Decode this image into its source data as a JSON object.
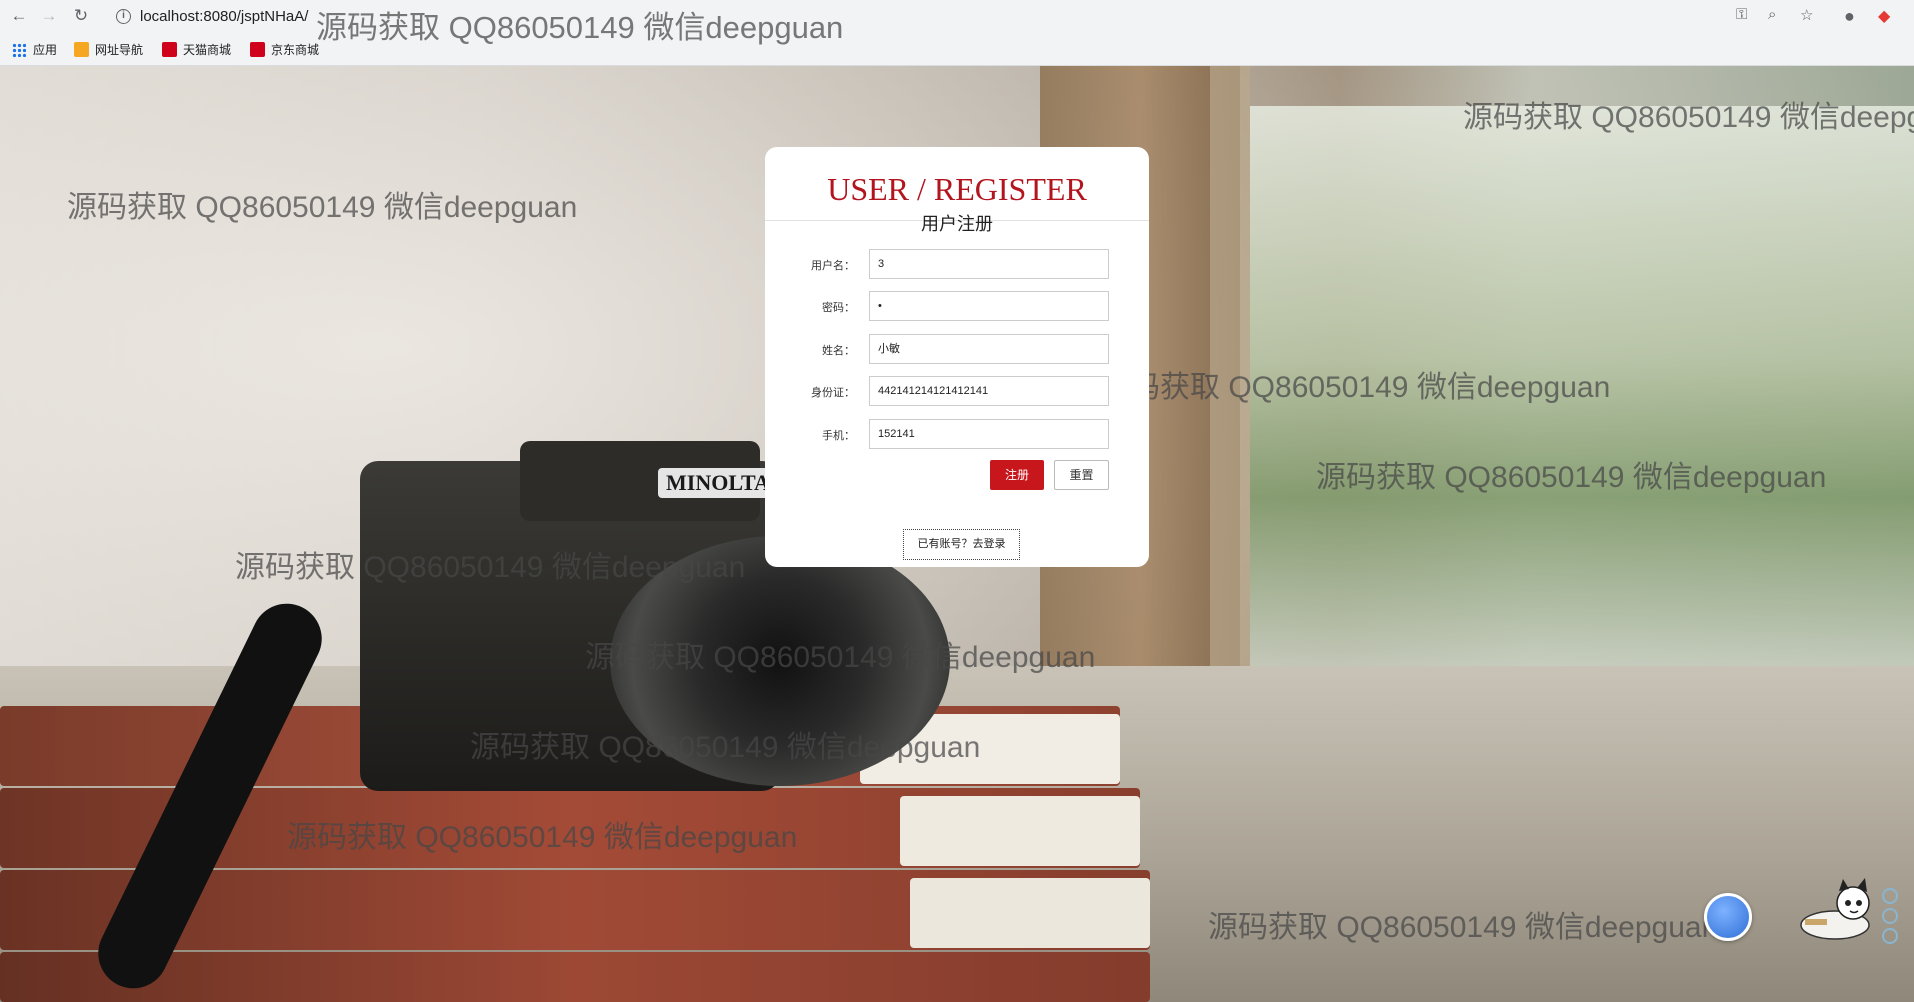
{
  "browser": {
    "url": "localhost:8080/jsptNHaA/",
    "url_text": "localhost:8080/jsptNHaA/",
    "bookmarks": [
      {
        "label": "应用",
        "icon": "apps-grid-icon"
      },
      {
        "label": "网址导航",
        "icon": "star-folder-icon",
        "color": "#f5a623"
      },
      {
        "label": "天猫商城",
        "icon": "tmall-icon",
        "color": "#d0021b"
      },
      {
        "label": "京东商城",
        "icon": "jd-icon",
        "color": "#d0021b"
      }
    ]
  },
  "card": {
    "title": "USER / REGISTER",
    "subtitle": "用户注册",
    "fields": [
      {
        "label": "用户名：",
        "value": "3"
      },
      {
        "label": "密码：",
        "value": "•"
      },
      {
        "label": "姓名：",
        "value": "小敏"
      },
      {
        "label": "身份证：",
        "value": "442141214121412141"
      },
      {
        "label": "手机：",
        "value": "152141"
      }
    ],
    "submit_label": "注册",
    "reset_label": "重置",
    "login_link": "已有账号？去登录"
  },
  "watermark_text": "源码获取 QQ86050149 微信deepguan",
  "colors": {
    "accent": "#c8161d",
    "title": "#b3151f"
  }
}
